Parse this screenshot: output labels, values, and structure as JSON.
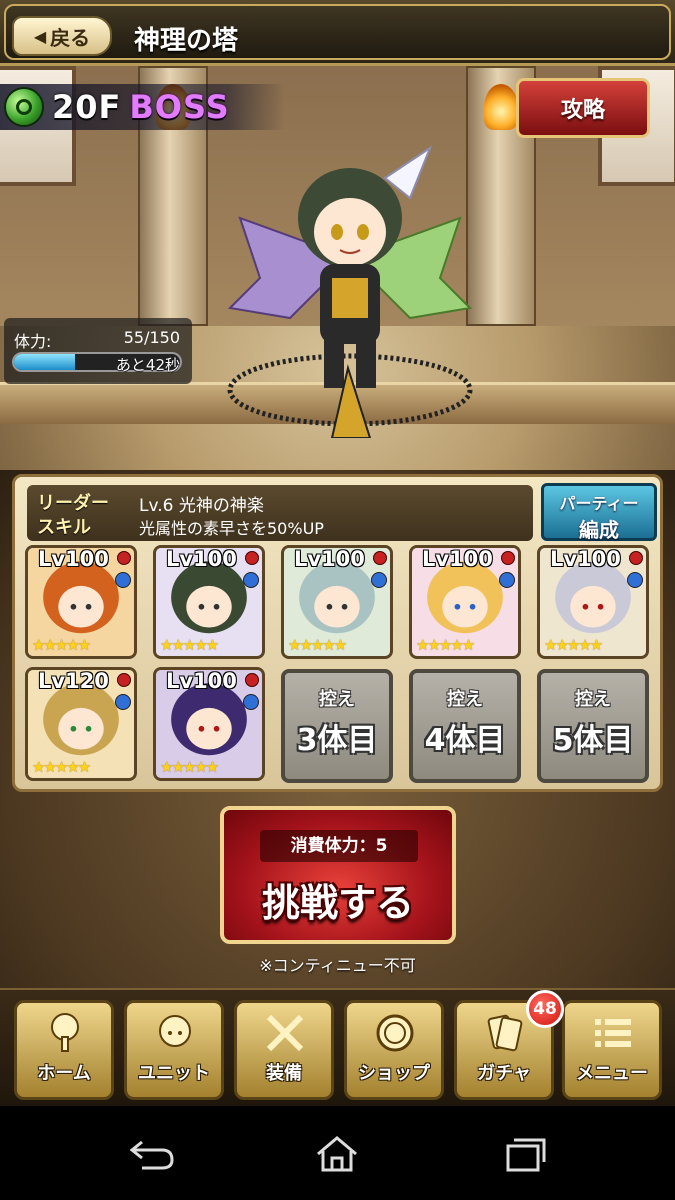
{
  "header": {
    "back_label": "戻る",
    "title": "神理の塔"
  },
  "stage": {
    "floor": "20F",
    "boss": "BOSS",
    "strategy_label": "攻略",
    "stamina": {
      "label": "体力:",
      "value": "55/150",
      "timer": "あと42秒",
      "fill": 0.367
    }
  },
  "party": {
    "leader_key1": "リーダー",
    "leader_key2": "スキル",
    "leader_skill_name": "Lv.6 光神の神楽",
    "leader_skill_desc": "光属性の素早さを50%UP",
    "edit_label_1": "パーティー",
    "edit_label_2": "編成",
    "units": [
      {
        "level": "Lv100",
        "stars": "★★★★★",
        "attr": "#2f6fd6",
        "hair": "#d2621d"
      },
      {
        "level": "Lv100",
        "stars": "★★★★★",
        "attr": "#2f6fd6",
        "hair": "#3a4a32"
      },
      {
        "level": "Lv100",
        "stars": "★★★★★",
        "attr": "#2f6fd6",
        "hair": "#a9c3c3"
      },
      {
        "level": "Lv100",
        "stars": "★★★★★",
        "attr": "#2f6fd6",
        "hair": "#f1c25a"
      },
      {
        "level": "Lv100",
        "stars": "★★★★★",
        "attr": "#2f6fd6",
        "hair": "#c9c9d8"
      },
      {
        "level": "Lv120",
        "stars": "★★★★★",
        "attr": "#2f6fd6",
        "hair": "#c9a552"
      },
      {
        "level": "Lv100",
        "stars": "★★★★★",
        "attr": "#2f6fd6",
        "hair": "#3e2a6e"
      }
    ],
    "reserves": [
      {
        "top": "控え",
        "bottom": "3体目"
      },
      {
        "top": "控え",
        "bottom": "4体目"
      },
      {
        "top": "控え",
        "bottom": "5体目"
      }
    ]
  },
  "challenge": {
    "cost": "消費体力：5",
    "label": "挑戦する",
    "note": "※コンティニュー不可"
  },
  "nav": {
    "items": [
      {
        "label": "ホーム",
        "icon": "tree-icon"
      },
      {
        "label": "ユニット",
        "icon": "character-icon"
      },
      {
        "label": "装備",
        "icon": "crossed-swords-icon"
      },
      {
        "label": "ショップ",
        "icon": "coin-icon"
      },
      {
        "label": "ガチャ",
        "icon": "cards-icon"
      },
      {
        "label": "メニュー",
        "icon": "menu-icon"
      }
    ],
    "gacha_badge": "48"
  },
  "colors": {
    "accent_gold": "#c8ab5c",
    "boss_purple": "#e27cff",
    "challenge_red": "#a3121a"
  }
}
